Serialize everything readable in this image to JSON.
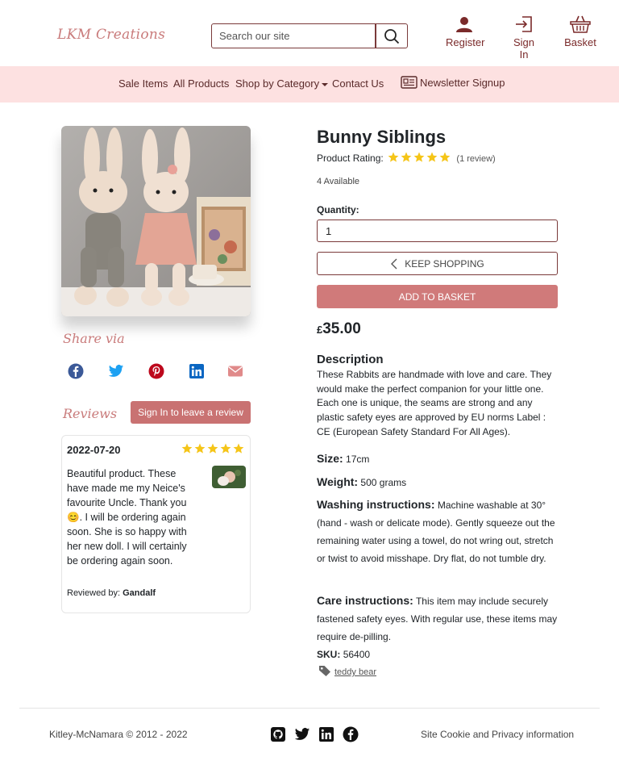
{
  "header": {
    "logo": "LKM Creations",
    "search_placeholder": "Search our site",
    "register": "Register",
    "sign_in": "Sign In",
    "basket": "Basket"
  },
  "nav": {
    "items": [
      "Sale Items",
      "All Products",
      "Shop by Category",
      "Contact Us",
      "Newsletter Signup"
    ]
  },
  "share": {
    "title": "Share via",
    "icons": [
      "facebook-icon",
      "twitter-icon",
      "pinterest-icon",
      "linkedin-icon",
      "email-icon"
    ]
  },
  "reviews": {
    "title": "Reviews",
    "button": "Sign In to leave a review",
    "items": [
      {
        "date": "2022-07-20",
        "stars": 5,
        "text_1": "Beautiful product. These have made me my Neice's favourite Uncle. Thank you",
        "emoji": "😊",
        "text_2": ". I will be ordering again soon. She is so happy with her new doll. I will certainly be ordering again soon.",
        "reviewed_by_label": "Reviewed by:",
        "reviewer": "Gandalf"
      }
    ]
  },
  "product": {
    "title": "Bunny Siblings",
    "rating_label": "Product Rating:",
    "rating": 5,
    "review_count": "(1 review)",
    "available": "4 Available",
    "quantity_label": "Quantity:",
    "quantity": "1",
    "keep_shopping": "KEEP SHOPPING",
    "add_to_basket": "ADD TO BASKET",
    "currency": "£",
    "price": "35.00",
    "description_head": "Description",
    "description": "These Rabbits are handmade with love and care. They would make the perfect companion for your little one. Each one is unique, the seams are strong and any plastic safety eyes are approved by EU norms Label : CE (European Safety Standard For All Ages).",
    "size_label": "Size:",
    "size": "17cm",
    "weight_label": "Weight:",
    "weight": "500 grams",
    "washing_label": "Washing instructions:",
    "washing": "Machine washable at 30° (hand - wash or delicate mode). Gently squeeze out the remaining water using a towel, do not wring out, stretch or twist to avoid misshape. Dry flat, do not tumble dry.",
    "care_label": "Care instructions:",
    "care": "This item may include securely fastened safety eyes. With regular use, these items may require de-pilling.",
    "sku_label": "SKU:",
    "sku": "56400",
    "tag": "teddy bear"
  },
  "footer": {
    "copyright": "Kitley-McNamara © 2012 - 2022",
    "icons": [
      "github-icon",
      "twitter-icon",
      "linkedin-icon",
      "facebook-icon"
    ],
    "cookie": "Site Cookie and Privacy information"
  },
  "colors": {
    "accent": "#c97272",
    "nav_bg": "#fde1e1",
    "brand_dark": "#7a2a2a",
    "star": "#f5c518"
  }
}
